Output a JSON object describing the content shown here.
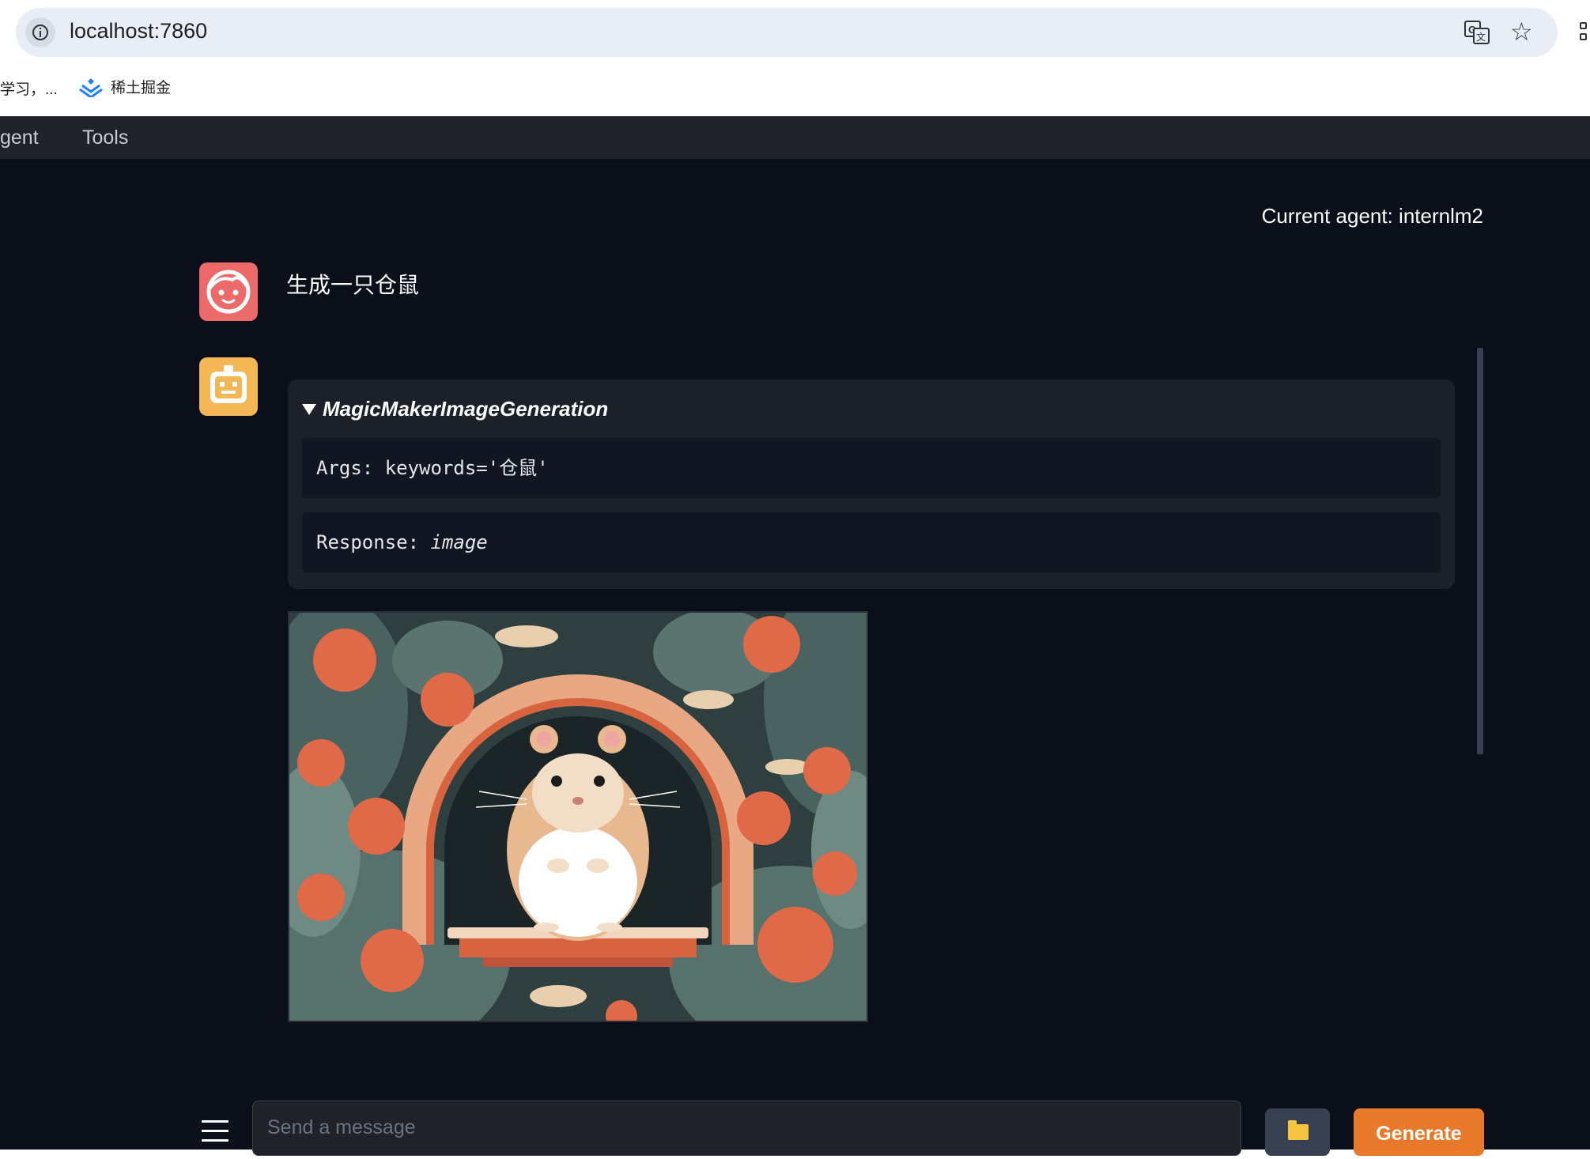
{
  "browser": {
    "url": "localhost:7860",
    "bookmarks": [
      {
        "label": "学习，..."
      },
      {
        "label": "稀土掘金",
        "icon": "juejin-icon"
      }
    ]
  },
  "nav": {
    "tabs": [
      {
        "label": "gent"
      },
      {
        "label": "Tools"
      }
    ]
  },
  "chat": {
    "current_agent": "Current agent: internlm2",
    "user_message": "生成一只仓鼠",
    "tool_call": {
      "name": "MagicMakerImageGeneration",
      "args_label": "Args:",
      "args_value": "keywords='仓鼠'",
      "response_label": "Response:",
      "response_value": "image"
    }
  },
  "composer": {
    "placeholder": "Send a message",
    "generate_label": "Generate"
  },
  "colors": {
    "app_bg": "#0b0f19",
    "user_avatar": "#ec6a6a",
    "bot_avatar": "#f4b756",
    "generate_button": "#e8792b"
  }
}
